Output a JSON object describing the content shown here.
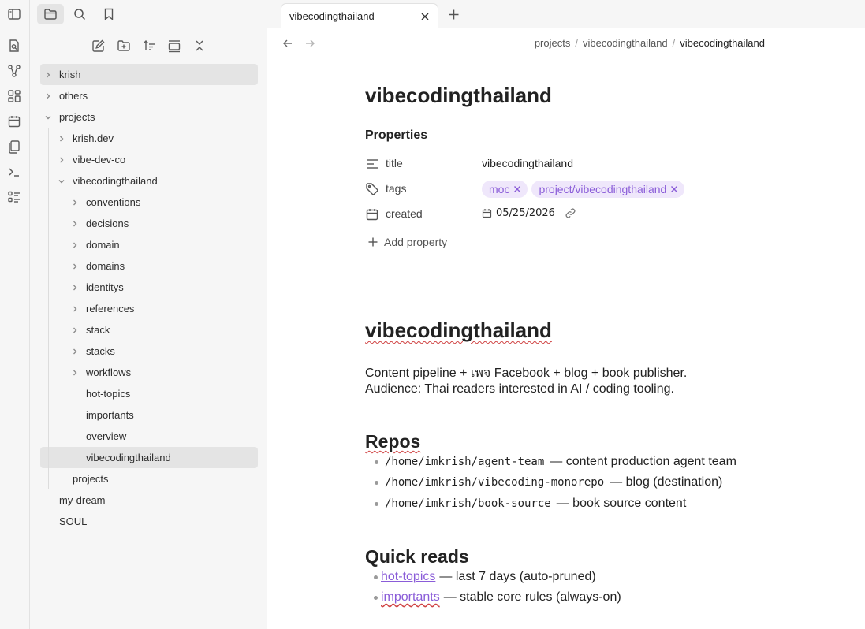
{
  "sidebar": {
    "tree": [
      {
        "label": "krish",
        "has_children": true,
        "expanded": false,
        "depth": 0,
        "selected": false,
        "hovered": true
      },
      {
        "label": "others",
        "has_children": true,
        "expanded": false,
        "depth": 0
      },
      {
        "label": "projects",
        "has_children": true,
        "expanded": true,
        "depth": 0
      },
      {
        "label": "krish.dev",
        "has_children": true,
        "expanded": false,
        "depth": 1
      },
      {
        "label": "vibe-dev-co",
        "has_children": true,
        "expanded": false,
        "depth": 1
      },
      {
        "label": "vibecodingthailand",
        "has_children": true,
        "expanded": true,
        "depth": 1
      },
      {
        "label": "conventions",
        "has_children": true,
        "expanded": false,
        "depth": 2
      },
      {
        "label": "decisions",
        "has_children": true,
        "expanded": false,
        "depth": 2
      },
      {
        "label": "domain",
        "has_children": true,
        "expanded": false,
        "depth": 2
      },
      {
        "label": "domains",
        "has_children": true,
        "expanded": false,
        "depth": 2
      },
      {
        "label": "identitys",
        "has_children": true,
        "expanded": false,
        "depth": 2
      },
      {
        "label": "references",
        "has_children": true,
        "expanded": false,
        "depth": 2
      },
      {
        "label": "stack",
        "has_children": true,
        "expanded": false,
        "depth": 2
      },
      {
        "label": "stacks",
        "has_children": true,
        "expanded": false,
        "depth": 2
      },
      {
        "label": "workflows",
        "has_children": true,
        "expanded": false,
        "depth": 2
      },
      {
        "label": "hot-topics",
        "has_children": false,
        "depth": 2
      },
      {
        "label": "importants",
        "has_children": false,
        "depth": 2
      },
      {
        "label": "overview",
        "has_children": false,
        "depth": 2
      },
      {
        "label": "vibecodingthailand",
        "has_children": false,
        "depth": 2,
        "selected": true
      },
      {
        "label": "projects",
        "has_children": false,
        "depth": 1
      },
      {
        "label": "my-dream",
        "has_children": false,
        "depth": 0
      },
      {
        "label": "SOUL",
        "has_children": false,
        "depth": 0
      }
    ]
  },
  "tabs": [
    {
      "title": "vibecodingthailand",
      "active": true
    }
  ],
  "breadcrumb": {
    "parts": [
      "projects",
      "vibecodingthailand"
    ],
    "current": "vibecodingthailand"
  },
  "note": {
    "inline_title": "vibecodingthailand",
    "properties_heading": "Properties",
    "properties": {
      "title": {
        "key": "title",
        "value": "vibecodingthailand"
      },
      "tags": {
        "key": "tags",
        "values": [
          "moc",
          "project/vibecodingthailand"
        ]
      },
      "created": {
        "key": "created",
        "value": "05/25/2026"
      }
    },
    "add_property": "Add property",
    "h1": "vibecodingthailand",
    "intro_line1": "Content pipeline + เพจ Facebook + blog + book publisher.",
    "intro_line2": "Audience: Thai readers interested in AI / coding tooling.",
    "repos_heading": "Repos",
    "repos": [
      {
        "path": "/home/imkrish/agent-team",
        "desc": "— content production agent team"
      },
      {
        "path": "/home/imkrish/vibecoding-monorepo",
        "desc": "— blog (destination)"
      },
      {
        "path": "/home/imkrish/book-source",
        "desc": "— book source content"
      }
    ],
    "quick_heading": "Quick reads",
    "quick_reads": [
      {
        "link": "hot-topics",
        "desc": "— last 7 days (auto-pruned)"
      },
      {
        "link": "importants",
        "desc": "— stable core rules (always-on)"
      }
    ]
  },
  "colors": {
    "accent": "#8a5cd8",
    "tag_bg": "#efe7fb",
    "sidebar_bg": "#f6f6f6",
    "selected_bg": "#e4e4e4"
  }
}
